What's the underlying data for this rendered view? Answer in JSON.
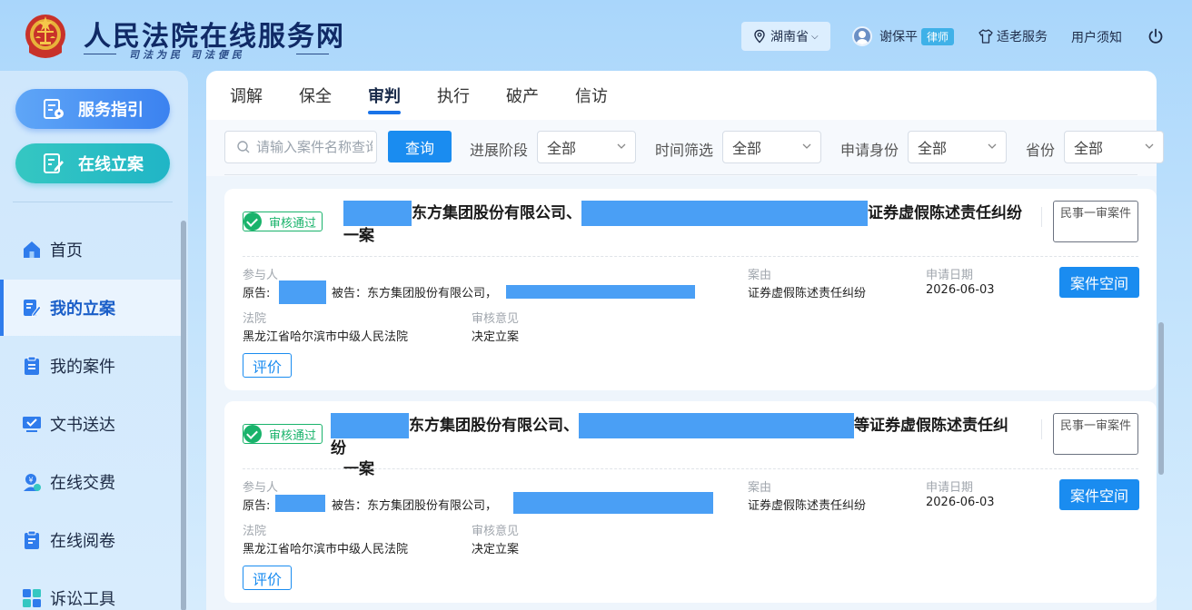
{
  "header": {
    "site_title": "人民法院在线服务网",
    "slogan": "司法为民  司法便民",
    "region": "湖南省",
    "user_name": "谢保平",
    "user_role": "律师",
    "elder_service": "适老服务",
    "user_notice": "用户须知"
  },
  "sidebar": {
    "guide_button": "服务指引",
    "file_button": "在线立案",
    "items": [
      {
        "label": "首页"
      },
      {
        "label": "我的立案"
      },
      {
        "label": "我的案件"
      },
      {
        "label": "文书送达"
      },
      {
        "label": "在线交费"
      },
      {
        "label": "在线阅卷"
      },
      {
        "label": "诉讼工具"
      }
    ],
    "active_index": 1
  },
  "tabs": [
    {
      "label": "调解"
    },
    {
      "label": "保全"
    },
    {
      "label": "审判"
    },
    {
      "label": "执行"
    },
    {
      "label": "破产"
    },
    {
      "label": "信访"
    }
  ],
  "active_tab": "审判",
  "filters": {
    "search_placeholder": "请输入案件名称查询",
    "query_button": "查询",
    "stage_label": "进展阶段",
    "stage_value": "全部",
    "time_label": "时间筛选",
    "time_value": "全部",
    "identity_label": "申请身份",
    "identity_value": "全部",
    "province_label": "省份",
    "province_value": "全部"
  },
  "cards": [
    {
      "status": "审核通过",
      "title_part1": "东方集团股份有限公司、",
      "title_part2": "证券虚假陈述责任纠纷",
      "title_part3": "一案",
      "case_type": "民事一审案件",
      "participants_label": "参与人",
      "plaintiff_label": "原告:",
      "defendant_text": "被告：东方集团股份有限公司，",
      "cause_label": "案由",
      "cause_value": "证券虚假陈述责任纠纷",
      "date_label": "申请日期",
      "date_value": "2026-06-03",
      "court_label": "法院",
      "court_value": "黑龙江省哈尔滨市中级人民法院",
      "opinion_label": "审核意见",
      "opinion_value": "决定立案",
      "space_button": "案件空间",
      "rate_button": "评价"
    },
    {
      "status": "审核通过",
      "title_part1": "东方集团股份有限公司、",
      "title_part2": "等证券虚假陈述责任纠纷",
      "title_part3": "一案",
      "case_type": "民事一审案件",
      "participants_label": "参与人",
      "plaintiff_label": "原告:",
      "defendant_text": "被告：东方集团股份有限公司，",
      "cause_label": "案由",
      "cause_value": "证券虚假陈述责任纠纷",
      "date_label": "申请日期",
      "date_value": "2026-06-03",
      "court_label": "法院",
      "court_value": "黑龙江省哈尔滨市中级人民法院",
      "opinion_label": "审核意见",
      "opinion_value": "决定立案",
      "space_button": "案件空间",
      "rate_button": "评价"
    }
  ],
  "colors": {
    "brand_navy": "#102a66",
    "primary_blue": "#1a8cf0",
    "success_green": "#19b36b",
    "redaction_blue": "#4a9ff5"
  }
}
